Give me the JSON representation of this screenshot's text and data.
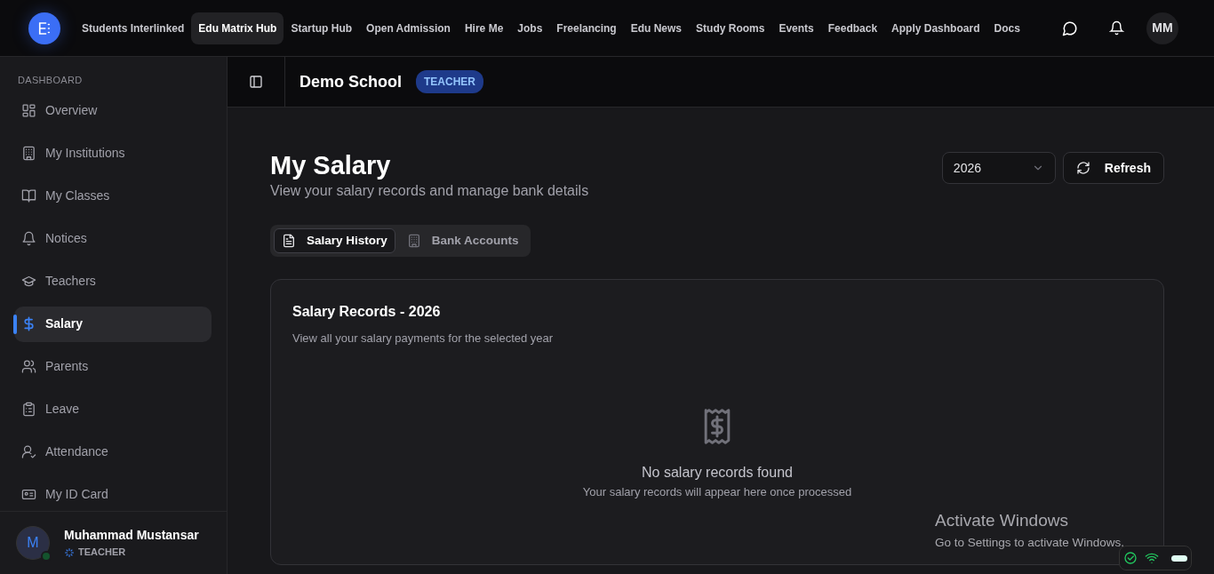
{
  "top_nav": {
    "items": [
      {
        "label": "Students Interlinked",
        "selected": false
      },
      {
        "label": "Edu Matrix Hub",
        "selected": true
      },
      {
        "label": "Startup Hub",
        "selected": false
      },
      {
        "label": "Open Admission",
        "selected": false
      },
      {
        "label": "Hire Me",
        "selected": false
      },
      {
        "label": "Jobs",
        "selected": false
      },
      {
        "label": "Freelancing",
        "selected": false
      },
      {
        "label": "Edu News",
        "selected": false
      },
      {
        "label": "Study Rooms",
        "selected": false
      },
      {
        "label": "Events",
        "selected": false
      },
      {
        "label": "Feedback",
        "selected": false
      },
      {
        "label": "Apply Dashboard",
        "selected": false
      },
      {
        "label": "Docs",
        "selected": false
      }
    ],
    "avatar_initials": "MM"
  },
  "sidebar": {
    "section_label": "DASHBOARD",
    "items": [
      {
        "label": "Overview",
        "selected": false
      },
      {
        "label": "My Institutions",
        "selected": false
      },
      {
        "label": "My Classes",
        "selected": false
      },
      {
        "label": "Notices",
        "selected": false
      },
      {
        "label": "Teachers",
        "selected": false
      },
      {
        "label": "Salary",
        "selected": true
      },
      {
        "label": "Parents",
        "selected": false
      },
      {
        "label": "Leave",
        "selected": false
      },
      {
        "label": "Attendance",
        "selected": false
      },
      {
        "label": "My ID Card",
        "selected": false
      }
    ],
    "user": {
      "initials": "M",
      "name": "Muhammad Mustansar",
      "role": "TEACHER",
      "online": true
    }
  },
  "header": {
    "school": "Demo School",
    "role_badge": "TEACHER"
  },
  "page": {
    "title": "My Salary",
    "subtitle": "View your salary records and manage bank details",
    "year_select": {
      "value": "2026"
    },
    "refresh_button": "Refresh",
    "tabs": [
      {
        "label": "Salary History",
        "selected": true
      },
      {
        "label": "Bank Accounts",
        "selected": false
      }
    ],
    "card": {
      "title": "Salary Records - 2026",
      "subtitle": "View all your salary payments for the selected year",
      "empty_title": "No salary records found",
      "empty_text": "Your salary records will appear here once processed"
    }
  },
  "os_overlay": {
    "title": "Activate Windows",
    "text": "Go to Settings to activate Windows."
  }
}
